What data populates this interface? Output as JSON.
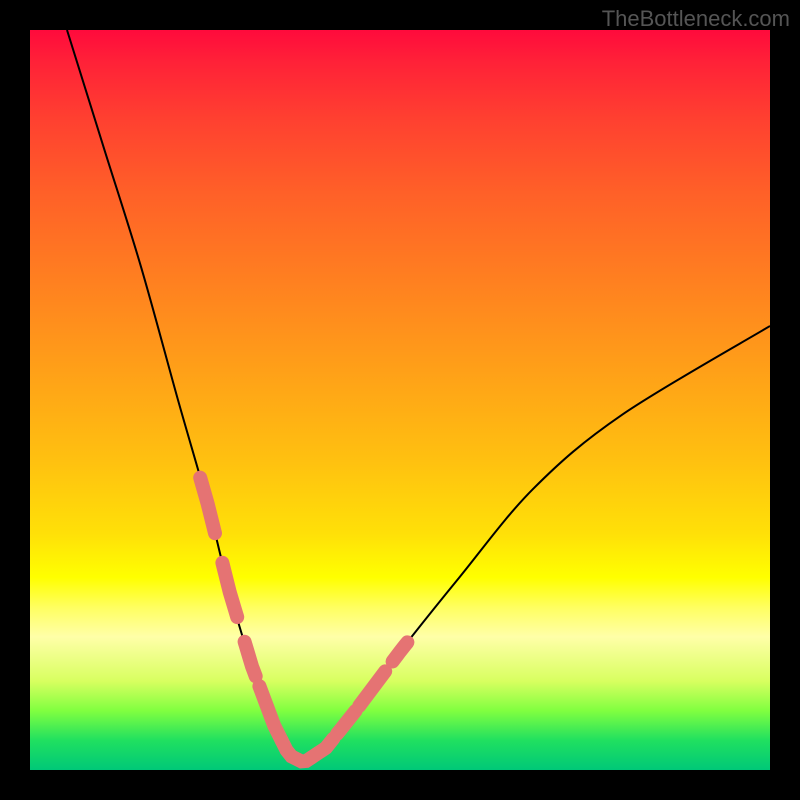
{
  "watermark": "TheBottleneck.com",
  "chart_data": {
    "type": "line",
    "title": "",
    "xlabel": "",
    "ylabel": "",
    "xlim": [
      0,
      100
    ],
    "ylim": [
      0,
      100
    ],
    "grid": false,
    "legend": false,
    "description": "Asymmetric V-curve over vertical rainbow gradient (red=top/bad, green=bottom/optimal). Minimum lies near x≈35. Left branch descends steeply from top-left; right branch rises more gently to mid-right. Short pink overlay segments mark data points on both branches near the trough.",
    "series": [
      {
        "name": "curve",
        "x": [
          5,
          10,
          15,
          20,
          24,
          27,
          30,
          33,
          35,
          37,
          40,
          44,
          50,
          58,
          68,
          80,
          100
        ],
        "y": [
          100,
          84,
          68,
          50,
          36,
          24,
          14,
          6,
          2,
          1,
          3,
          8,
          16,
          26,
          38,
          48,
          60
        ]
      }
    ],
    "highlight_segments_x": [
      [
        23,
        25
      ],
      [
        26,
        28
      ],
      [
        29,
        30.5
      ],
      [
        31,
        34
      ],
      [
        34,
        38
      ],
      [
        38,
        41
      ],
      [
        41.5,
        44
      ],
      [
        44.5,
        48
      ],
      [
        49,
        51
      ]
    ],
    "colors": {
      "curve": "#000000",
      "highlight": "#e57373",
      "gradient_top": "#ff0a3c",
      "gradient_bottom": "#00c878"
    }
  }
}
